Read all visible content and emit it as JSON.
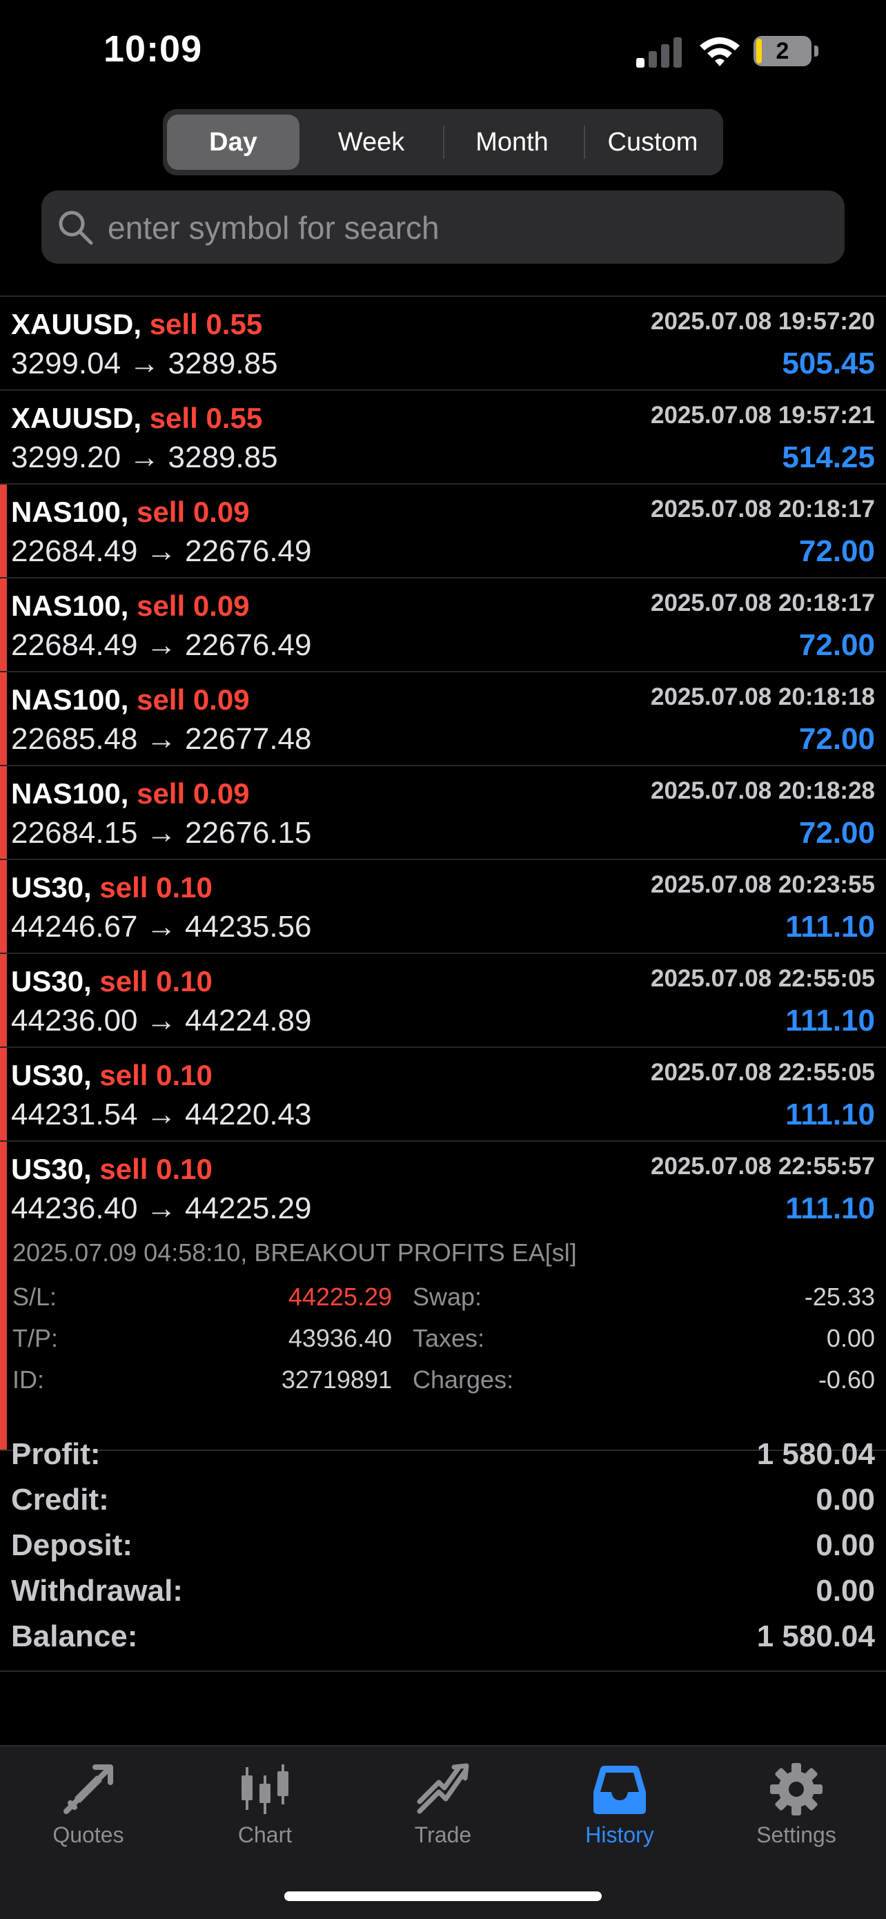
{
  "status": {
    "time": "10:09",
    "battery": "2",
    "battery_color": "#ffd60a"
  },
  "periods": [
    "Day",
    "Week",
    "Month",
    "Custom"
  ],
  "search": {
    "placeholder": "enter symbol for search"
  },
  "deals": [
    {
      "symbol": "XAUUSD,",
      "side": "sell 0.55",
      "date": "2025.07.08 19:57:20",
      "prices": "3299.04 → 3289.85",
      "profit": "505.45",
      "marked": false
    },
    {
      "symbol": "XAUUSD,",
      "side": "sell 0.55",
      "date": "2025.07.08 19:57:21",
      "prices": "3299.20 → 3289.85",
      "profit": "514.25",
      "marked": false
    },
    {
      "symbol": "NAS100,",
      "side": "sell 0.09",
      "date": "2025.07.08 20:18:17",
      "prices": "22684.49 → 22676.49",
      "profit": "72.00",
      "marked": true
    },
    {
      "symbol": "NAS100,",
      "side": "sell 0.09",
      "date": "2025.07.08 20:18:17",
      "prices": "22684.49 → 22676.49",
      "profit": "72.00",
      "marked": true
    },
    {
      "symbol": "NAS100,",
      "side": "sell 0.09",
      "date": "2025.07.08 20:18:18",
      "prices": "22685.48 → 22677.48",
      "profit": "72.00",
      "marked": true
    },
    {
      "symbol": "NAS100,",
      "side": "sell 0.09",
      "date": "2025.07.08 20:18:28",
      "prices": "22684.15 → 22676.15",
      "profit": "72.00",
      "marked": true
    },
    {
      "symbol": "US30,",
      "side": "sell 0.10",
      "date": "2025.07.08 20:23:55",
      "prices": "44246.67 → 44235.56",
      "profit": "111.10",
      "marked": true
    },
    {
      "symbol": "US30,",
      "side": "sell 0.10",
      "date": "2025.07.08 22:55:05",
      "prices": "44236.00 → 44224.89",
      "profit": "111.10",
      "marked": true
    },
    {
      "symbol": "US30,",
      "side": "sell 0.10",
      "date": "2025.07.08 22:55:05",
      "prices": "44231.54 → 44220.43",
      "profit": "111.10",
      "marked": true
    },
    {
      "symbol": "US30,",
      "side": "sell 0.10",
      "date": "2025.07.08 22:55:57",
      "prices": "44236.40 → 44225.29",
      "profit": "111.10",
      "marked": true
    }
  ],
  "details": {
    "comment": "2025.07.09 04:58:10, BREAKOUT PROFITS EA[sl]",
    "sl_label": "S/L:",
    "sl_value": "44225.29",
    "tp_label": "T/P:",
    "tp_value": "43936.40",
    "id_label": "ID:",
    "id_value": "32719891",
    "swap_label": "Swap:",
    "swap_value": "-25.33",
    "taxes_label": "Taxes:",
    "taxes_value": "0.00",
    "charges_label": "Charges:",
    "charges_value": "-0.60"
  },
  "totals": [
    {
      "label": "Profit:",
      "value": "1 580.04"
    },
    {
      "label": "Credit:",
      "value": "0.00"
    },
    {
      "label": "Deposit:",
      "value": "0.00"
    },
    {
      "label": "Withdrawal:",
      "value": "0.00"
    },
    {
      "label": "Balance:",
      "value": "1 580.04"
    }
  ],
  "tabs": [
    {
      "label": "Quotes",
      "icon": "quotes-icon"
    },
    {
      "label": "Chart",
      "icon": "chart-icon"
    },
    {
      "label": "Trade",
      "icon": "trade-icon"
    },
    {
      "label": "History",
      "icon": "history-icon"
    },
    {
      "label": "Settings",
      "icon": "gear-icon"
    }
  ],
  "colors": {
    "sell": "#ff453a",
    "profit": "#2f8cff",
    "marker": "#e5423a",
    "active_tab": "#2f8cff"
  }
}
